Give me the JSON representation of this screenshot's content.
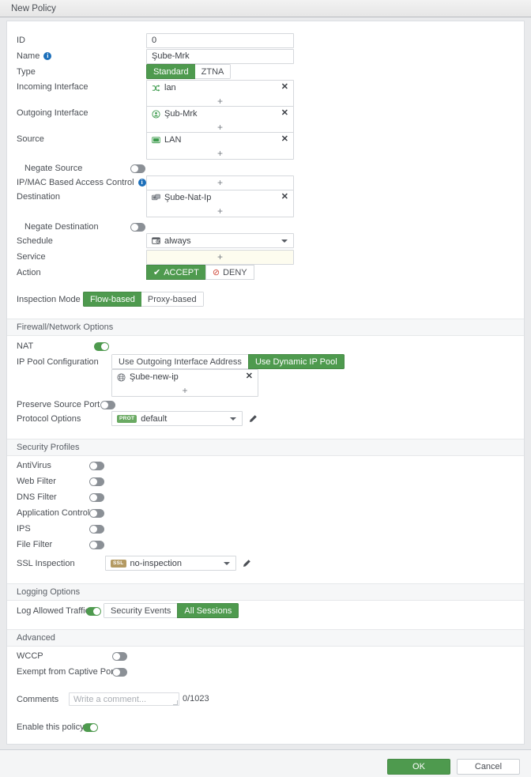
{
  "window": {
    "title": "New Policy"
  },
  "fields": {
    "id": {
      "label": "ID",
      "value": "0"
    },
    "name": {
      "label": "Name",
      "value": "Şube-Mrk",
      "info_icon": "info-icon"
    },
    "type": {
      "label": "Type",
      "options": [
        "Standard",
        "ZTNA"
      ],
      "selected": "Standard"
    },
    "incoming_interface": {
      "label": "Incoming Interface",
      "items": [
        {
          "name": "lan",
          "icon": "interface-icon"
        }
      ],
      "add_label": "+"
    },
    "outgoing_interface": {
      "label": "Outgoing Interface",
      "items": [
        {
          "name": "Şub-Mrk",
          "icon": "tunnel-icon"
        }
      ],
      "add_label": "+"
    },
    "source": {
      "label": "Source",
      "items": [
        {
          "name": "LAN",
          "icon": "address-icon"
        }
      ],
      "add_label": "+"
    },
    "negate_source": {
      "label": "Negate Source",
      "state": "off"
    },
    "ipmac_access_control": {
      "label": "IP/MAC Based Access Control",
      "info_icon": "info-icon",
      "add_label": "+"
    },
    "destination": {
      "label": "Destination",
      "items": [
        {
          "name": "Şube-Nat-Ip",
          "icon": "address-group-icon"
        }
      ],
      "add_label": "+"
    },
    "negate_destination": {
      "label": "Negate Destination",
      "state": "off"
    },
    "schedule": {
      "label": "Schedule",
      "value": "always",
      "icon": "schedule-icon"
    },
    "service": {
      "label": "Service",
      "add_label": "+",
      "required_empty": true
    },
    "action": {
      "label": "Action",
      "options": [
        "ACCEPT",
        "DENY"
      ],
      "selected": "ACCEPT",
      "accept_icon": "check-icon",
      "deny_icon": "deny-icon"
    },
    "inspection_mode": {
      "label": "Inspection Mode",
      "options": [
        "Flow-based",
        "Proxy-based"
      ],
      "selected": "Flow-based"
    }
  },
  "firewall_network_options": {
    "title": "Firewall/Network Options",
    "nat": {
      "label": "NAT",
      "state": "on"
    },
    "ip_pool_configuration": {
      "label": "IP Pool Configuration",
      "options": [
        "Use Outgoing Interface Address",
        "Use Dynamic IP Pool"
      ],
      "selected": "Use Dynamic IP Pool",
      "items": [
        {
          "name": "Şube-new-ip",
          "icon": "ip-pool-icon"
        }
      ],
      "add_label": "+"
    },
    "preserve_source_port": {
      "label": "Preserve Source Port",
      "state": "off"
    },
    "protocol_options": {
      "label": "Protocol Options",
      "badge": "PROT",
      "value": "default",
      "edit_icon": "pencil-icon"
    }
  },
  "security_profiles": {
    "title": "Security Profiles",
    "toggles": [
      {
        "label": "AntiVirus",
        "state": "off"
      },
      {
        "label": "Web Filter",
        "state": "off"
      },
      {
        "label": "DNS Filter",
        "state": "off"
      },
      {
        "label": "Application Control",
        "state": "off"
      },
      {
        "label": "IPS",
        "state": "off"
      },
      {
        "label": "File Filter",
        "state": "off"
      }
    ],
    "ssl_inspection": {
      "label": "SSL Inspection",
      "badge": "SSL",
      "value": "no-inspection",
      "edit_icon": "pencil-icon"
    }
  },
  "logging_options": {
    "title": "Logging Options",
    "log_allowed_traffic": {
      "label": "Log Allowed Traffic",
      "state": "on",
      "options": [
        "Security Events",
        "All Sessions"
      ],
      "selected": "All Sessions"
    }
  },
  "advanced": {
    "title": "Advanced",
    "wccp": {
      "label": "WCCP",
      "state": "off"
    },
    "exempt_captive_portal": {
      "label": "Exempt from Captive Portal",
      "state": "off"
    }
  },
  "comments": {
    "label": "Comments",
    "placeholder": "Write a comment...",
    "value": "",
    "counter": "0/1023"
  },
  "enable_policy": {
    "label": "Enable this policy",
    "state": "on"
  },
  "footer": {
    "ok": "OK",
    "cancel": "Cancel"
  },
  "colors": {
    "accent_green": "#4e9a4e",
    "deny_red": "#d14b3c",
    "info_blue": "#1c6fba",
    "ssl_badge": "#b49a62",
    "prot_badge": "#6aaa63"
  }
}
